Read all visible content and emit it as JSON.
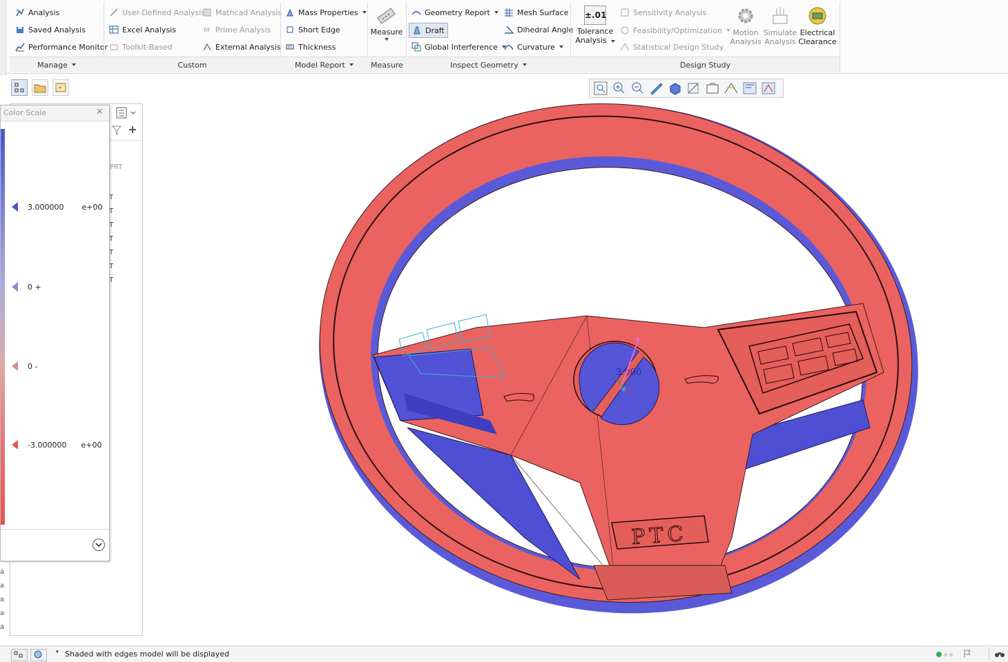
{
  "ribbon": {
    "manage": {
      "analysis": "Analysis",
      "saved_analysis": "Saved Analysis",
      "performance_monitor": "Performance Monitor",
      "group": "Manage"
    },
    "custom": {
      "user_defined": "User-Defined Analysis",
      "excel": "Excel Analysis",
      "toolkit": "Toolkit-Based",
      "mathcad": "Mathcad Analysis",
      "prime": "Prime Analysis",
      "external": "External Analysis",
      "group": "Custom"
    },
    "model_report": {
      "mass_properties": "Mass Properties",
      "short_edge": "Short Edge",
      "thickness": "Thickness",
      "group": "Model Report"
    },
    "measure": {
      "label": "Measure",
      "group": "Measure"
    },
    "inspect": {
      "geometry_report": "Geometry Report",
      "draft": "Draft",
      "global_interference": "Global Interference",
      "mesh_surface": "Mesh Surface",
      "dihedral_angle": "Dihedral Angle",
      "curvature": "Curvature",
      "group": "Inspect Geometry"
    },
    "design_study": {
      "tolerance_icon": "±.01",
      "tolerance_1": "Tolerance",
      "tolerance_2": "Analysis",
      "sensitivity": "Sensitivity Analysis",
      "feasibility": "Feasibility/Optimization",
      "statistical": "Statistical Design Study",
      "motion_1": "Motion",
      "motion_2": "Analysis",
      "simulate_1": "Simulate",
      "simulate_2": "Analysis",
      "electrical_1": "Electrical",
      "electrical_2": "Clearance",
      "group": "Design Study"
    }
  },
  "color_scale": {
    "title": "Color Scale",
    "max_value": "3.000000",
    "max_exp": "e+00",
    "zero_plus": "0 +",
    "zero_minus": "0 -",
    "min_value": "-3.000000",
    "min_exp": "e+00"
  },
  "tree": {
    "prt_label": "PRT",
    "rows": [
      "T",
      "T",
      "T",
      "T",
      "T",
      "T",
      "T"
    ]
  },
  "model": {
    "logo_text": "PTC",
    "draft_readout": "3.000"
  },
  "status": {
    "message": "Shaded with edges model will be displayed"
  },
  "colors": {
    "positive_draft": "#e8625e",
    "negative_draft": "#5a5ad8",
    "accent": "#2a5fa8"
  }
}
